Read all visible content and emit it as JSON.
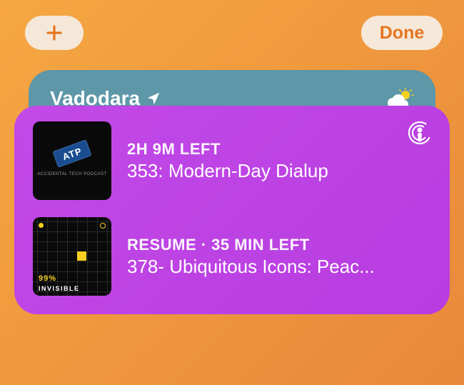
{
  "toolbar": {
    "done_label": "Done"
  },
  "weather": {
    "city": "Vadodara"
  },
  "podcasts": {
    "items": [
      {
        "meta": "2H 9M LEFT",
        "title": "353: Modern-Day Dialup",
        "artwork": {
          "badge": "ATP",
          "sub": "ACCIDENTAL TECH PODCAST"
        }
      },
      {
        "meta": "RESUME · 35 MIN LEFT",
        "title": "378- Ubiquitous Icons: Peac...",
        "artwork": {
          "line1": "99%",
          "line2": "INVISIBLE"
        }
      }
    ]
  }
}
